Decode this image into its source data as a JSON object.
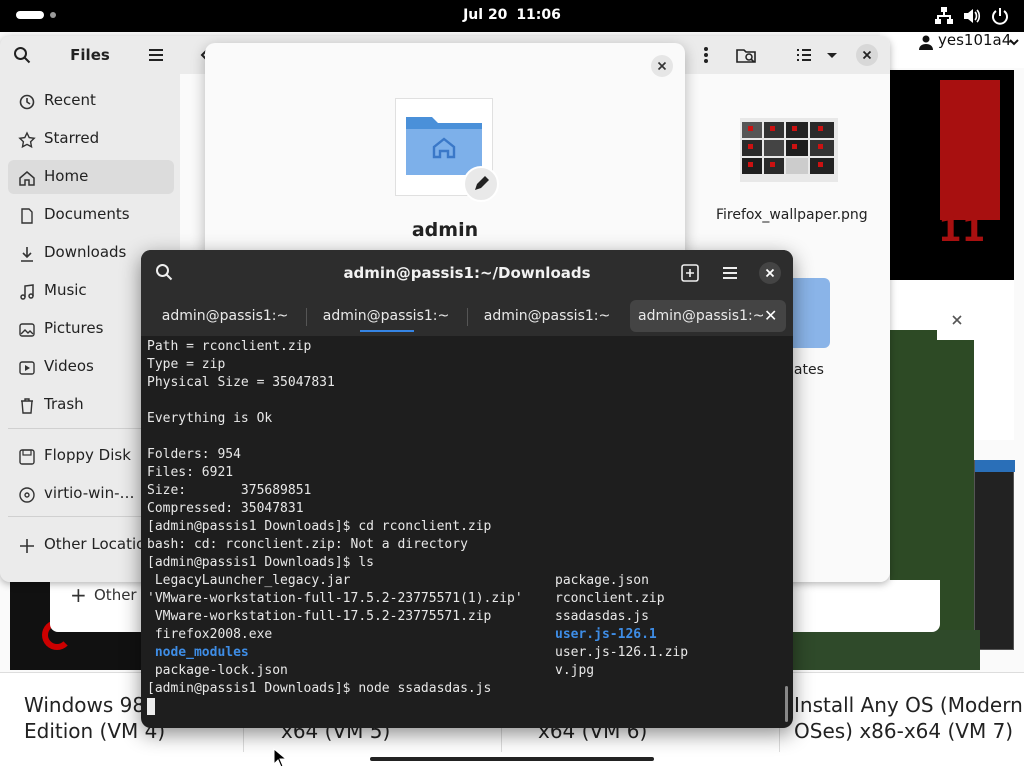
{
  "topbar": {
    "date": "Jul 20",
    "time": "11:06",
    "tray_icons": [
      "network-icon",
      "volume-icon",
      "power-icon"
    ]
  },
  "background": {
    "username": "yes101a4",
    "other_locations_label": "Other L",
    "vm_titles": [
      {
        "line1": "Windows 98 S",
        "line2": "Edition (VM 4)"
      },
      {
        "line1": "",
        "line2": "x64 (VM 5)"
      },
      {
        "line1": "",
        "line2": "x64 (VM 6)"
      },
      {
        "line1": "Install Any OS (Modern",
        "line2": "OSes) x86-x64 (VM 7)"
      }
    ],
    "right_number": "11"
  },
  "files": {
    "title": "Files",
    "sidebar": [
      {
        "label": "Recent",
        "icon": "clock-icon"
      },
      {
        "label": "Starred",
        "icon": "star-icon"
      },
      {
        "label": "Home",
        "icon": "home-icon",
        "active": true
      },
      {
        "label": "Documents",
        "icon": "document-icon"
      },
      {
        "label": "Downloads",
        "icon": "download-icon"
      },
      {
        "label": "Music",
        "icon": "music-icon"
      },
      {
        "label": "Pictures",
        "icon": "picture-icon"
      },
      {
        "label": "Videos",
        "icon": "video-icon"
      },
      {
        "label": "Trash",
        "icon": "trash-icon"
      },
      {
        "label": "Floppy Disk",
        "icon": "disk-icon"
      },
      {
        "label": "virtio-win-…",
        "icon": "disc-icon"
      },
      {
        "label": "Other Locations",
        "icon": "plus-icon"
      }
    ],
    "items": {
      "firefox_label": "Firefox_wallpaper.png",
      "templates_label": "lates"
    }
  },
  "properties": {
    "name": "admin"
  },
  "terminal": {
    "title": "admin@passis1:~/Downloads",
    "tabs": [
      {
        "label": "admin@passis1:~"
      },
      {
        "label": "admin@passis1:~"
      },
      {
        "label": "admin@passis1:~"
      },
      {
        "label": "admin@passis1:~"
      }
    ],
    "lines": [
      "Path = rconclient.zip",
      "Type = zip",
      "Physical Size = 35047831",
      "",
      "Everything is Ok",
      "",
      "Folders: 954",
      "Files: 6921",
      "Size:       375689851",
      "Compressed: 35047831",
      "[admin@passis1 Downloads]$ cd rconclient.zip",
      "bash: cd: rconclient.zip: Not a directory",
      "[admin@passis1 Downloads]$ ls"
    ],
    "ls_left": [
      {
        "text": " LegacyLauncher_legacy.jar",
        "dir": false
      },
      {
        "text": "'VMware-workstation-full-17.5.2-23775571(1).zip'",
        "dir": false
      },
      {
        "text": " VMware-workstation-full-17.5.2-23775571.zip",
        "dir": false
      },
      {
        "text": " firefox2008.exe",
        "dir": false
      },
      {
        "text": " node_modules",
        "dir": true
      },
      {
        "text": " package-lock.json",
        "dir": false
      }
    ],
    "ls_right": [
      {
        "text": "package.json",
        "dir": false
      },
      {
        "text": "rconclient.zip",
        "dir": false
      },
      {
        "text": "ssadasdas.js",
        "dir": false
      },
      {
        "text": "user.js-126.1",
        "dir": true
      },
      {
        "text": "user.js-126.1.zip",
        "dir": false
      },
      {
        "text": "v.jpg",
        "dir": false
      }
    ],
    "last_command": "[admin@passis1 Downloads]$ node ssadasdas.js"
  },
  "colors": {
    "accent": "#3584e4",
    "terminal_bg": "#1e1e1e",
    "directory": "#3e8de6"
  }
}
